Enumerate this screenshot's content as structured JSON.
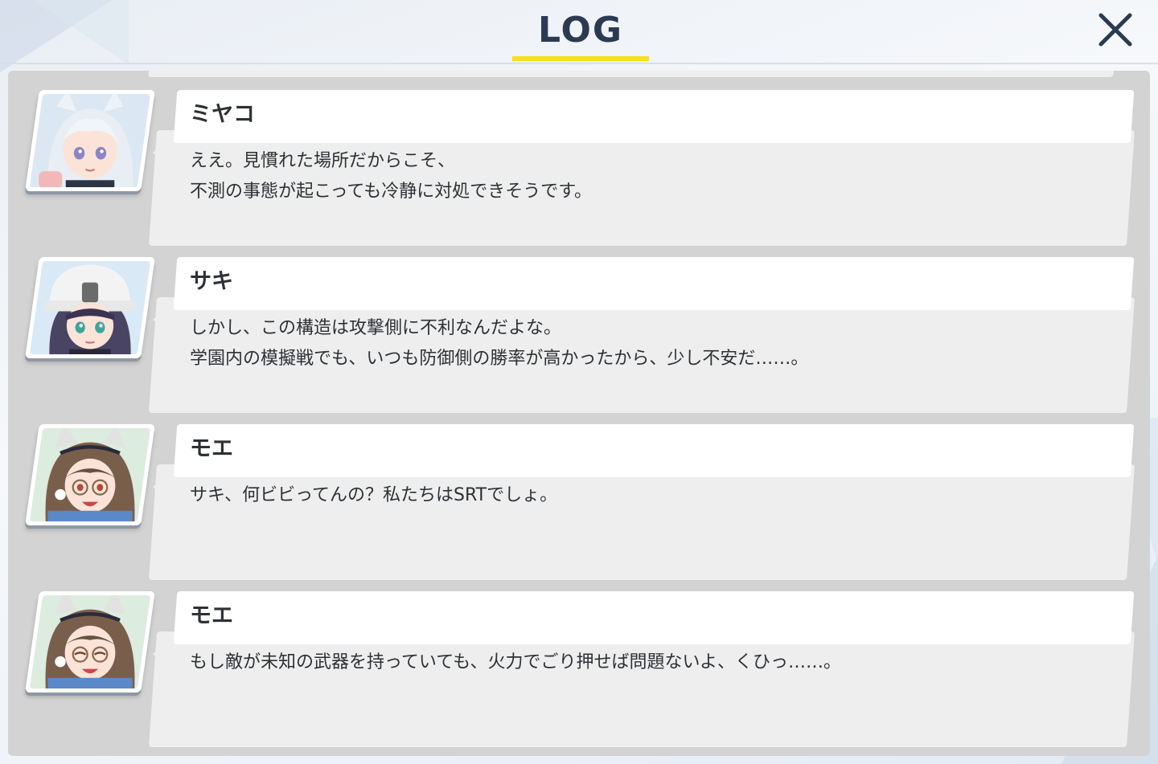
{
  "header": {
    "title": "LOG",
    "accent_color": "#f5e11e",
    "close_icon": "close-icon"
  },
  "log": {
    "entries": [
      {
        "speaker": "ミヤコ",
        "text": "ええ。見慣れた場所だからこそ、\n不測の事態が起こっても冷静に対処できそうです。",
        "portrait": "miyako-portrait"
      },
      {
        "speaker": "サキ",
        "text": "しかし、この構造は攻撃側に不利なんだよな。\n学園内の模擬戦でも、いつも防御側の勝率が高かったから、少し不安だ……。",
        "portrait": "saki-portrait"
      },
      {
        "speaker": "モエ",
        "text": "サキ、何ビビってんの？私たちはSRTでしょ。",
        "portrait": "moe-portrait"
      },
      {
        "speaker": "モエ",
        "text": "もし敵が未知の武器を持っていても、火力でごり押せば問題ないよ、くひっ……。",
        "portrait": "moe-portrait"
      }
    ]
  },
  "colors": {
    "panel_bg": "#d3d3d3",
    "name_bar": "#ffffff",
    "message_box": "#eeeeee",
    "text": "#2d3136",
    "title_text": "#2b3a52"
  }
}
